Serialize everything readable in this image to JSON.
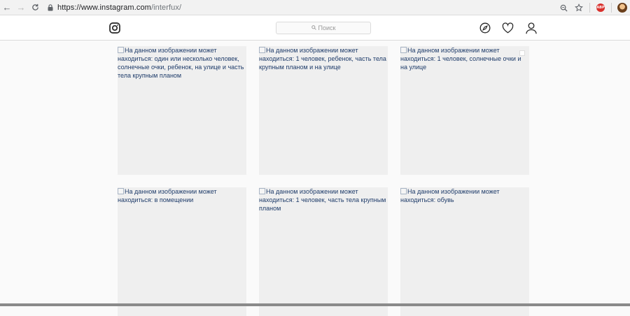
{
  "browser": {
    "url_host": "https://www.instagram.com",
    "url_path": "/interfux/",
    "back_glyph": "←",
    "forward_glyph": "→",
    "reload_glyph": "C",
    "abp_label": "ABP"
  },
  "header": {
    "search_placeholder": "Поиск"
  },
  "posts": [
    {
      "alt": "На данном изображении может находиться: один или несколько человек, солнечные очки, ребенок, на улице и часть тела крупным планом"
    },
    {
      "alt": "На данном изображении может находиться: 1 человек, ребенок, часть тела крупным планом и на улице"
    },
    {
      "alt": "На данном изображении может находиться: 1 человек, солнечные очки и на улице",
      "multi": true
    },
    {
      "alt": "На данном изображении может находиться: в помещении"
    },
    {
      "alt": "На данном изображении может находиться: 1 человек, часть тела крупным планом"
    },
    {
      "alt": "На данном изображении может находиться: обувь"
    }
  ],
  "colors": {
    "alt_text": "#1f3c6a",
    "tile_bg": "#efefef",
    "abp_red": "#d9302c"
  }
}
